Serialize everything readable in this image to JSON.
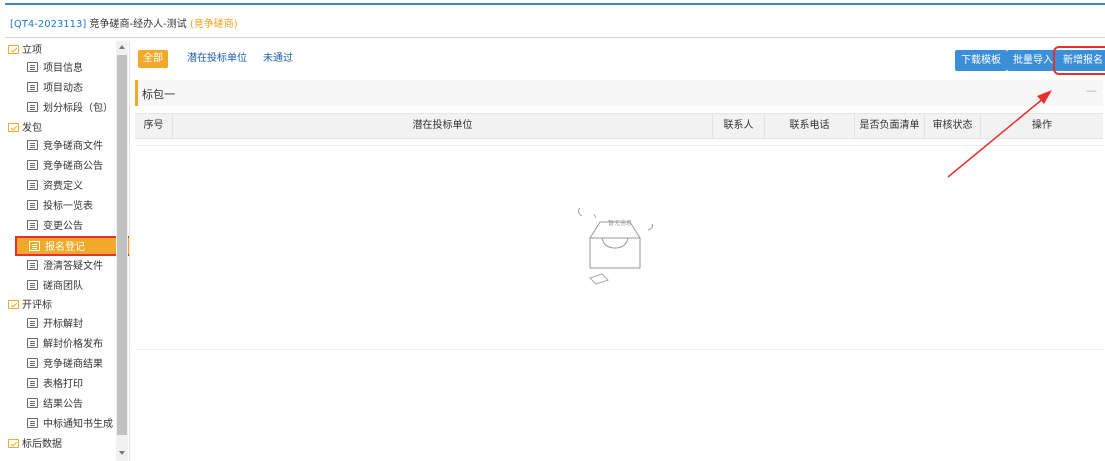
{
  "title": {
    "id": "[QT4-2023113]",
    "name": "竞争磋商-经办人-测试",
    "tag": "(竞争磋商)"
  },
  "sidebar": {
    "groups": [
      {
        "label": "立项",
        "items": [
          "项目信息",
          "项目动态",
          "划分标段（包）"
        ]
      },
      {
        "label": "发包",
        "items": [
          "竞争磋商文件",
          "竞争磋商公告",
          "资费定义",
          "投标一览表",
          "变更公告",
          "报名登记",
          "澄清答疑文件",
          "磋商团队"
        ]
      },
      {
        "label": "开评标",
        "items": [
          "开标解封",
          "解封价格发布",
          "竞争磋商结果",
          "表格打印",
          "结果公告",
          "中标通知书生成"
        ]
      },
      {
        "label": "标后数据",
        "items": []
      }
    ],
    "active_item": "报名登记"
  },
  "tabs": [
    "全部",
    "潜在投标单位",
    "未通过"
  ],
  "buttons": {
    "download": "下载模板",
    "import": "批量导入",
    "add": "新增报名"
  },
  "section": {
    "label": "标包一",
    "collapse": "—"
  },
  "table": {
    "columns": [
      "序号",
      "潜在投标单位",
      "联系人",
      "联系电话",
      "是否负面清单",
      "审核状态",
      "操作"
    ],
    "rows": []
  },
  "empty_text": "暂无信息",
  "colors": {
    "accent": "#f0a92a",
    "primary": "#3b8fd8",
    "highlight": "#e5302e"
  }
}
